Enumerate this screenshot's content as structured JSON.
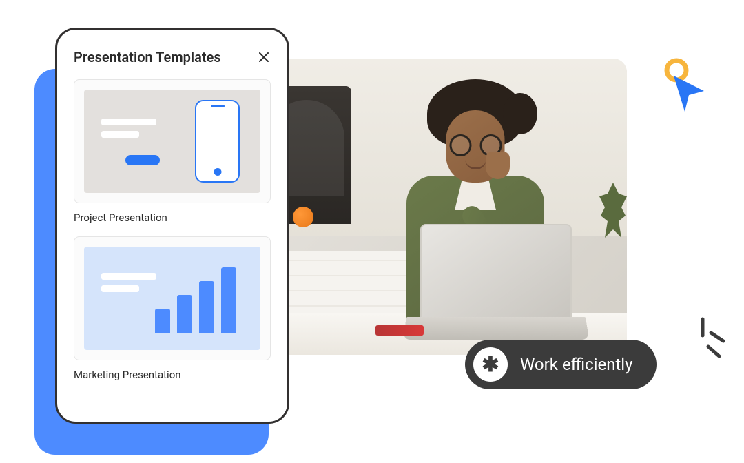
{
  "panel": {
    "title": "Presentation Templates",
    "templates": [
      {
        "label": "Project Presentation"
      },
      {
        "label": "Marketing Presentation"
      }
    ]
  },
  "badge": {
    "text": "Work efficiently",
    "icon": "✱"
  }
}
